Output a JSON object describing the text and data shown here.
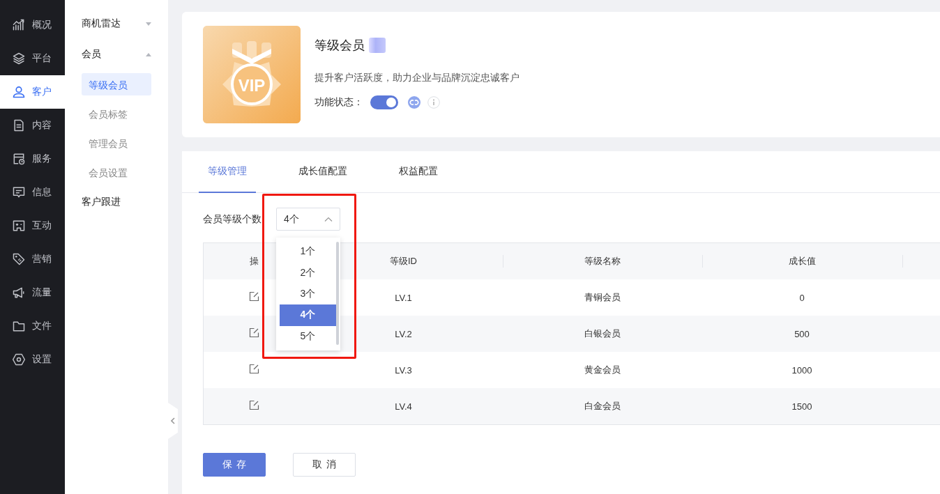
{
  "nav": [
    {
      "label": "概况",
      "selected": false
    },
    {
      "label": "平台",
      "selected": false
    },
    {
      "label": "客户",
      "selected": true
    },
    {
      "label": "内容",
      "selected": false
    },
    {
      "label": "服务",
      "selected": false
    },
    {
      "label": "信息",
      "selected": false
    },
    {
      "label": "互动",
      "selected": false
    },
    {
      "label": "营销",
      "selected": false
    },
    {
      "label": "流量",
      "selected": false
    },
    {
      "label": "文件",
      "selected": false
    },
    {
      "label": "设置",
      "selected": false
    }
  ],
  "subnav": [
    {
      "label": "商机雷达",
      "kind": "group",
      "expanded": false
    },
    {
      "label": "会员",
      "kind": "group",
      "expanded": true,
      "children": [
        {
          "label": "等级会员",
          "selected": true
        },
        {
          "label": "会员标签",
          "selected": false
        },
        {
          "label": "管理会员",
          "selected": false
        },
        {
          "label": "会员设置",
          "selected": false
        }
      ]
    },
    {
      "label": "客户跟进",
      "kind": "link"
    }
  ],
  "feature": {
    "badge_text": "VIP",
    "title": "等级会员",
    "description": "提升客户活跃度，助力企业与品牌沉淀忠诚客户",
    "status_label": "功能状态：",
    "enabled": true
  },
  "tabs": [
    {
      "label": "等级管理",
      "selected": true
    },
    {
      "label": "成长值配置",
      "selected": false
    },
    {
      "label": "权益配置",
      "selected": false
    }
  ],
  "count_field": {
    "label": "会员等级个数",
    "value": "4个",
    "expanded": true,
    "options": [
      {
        "label": "1个",
        "selected": false
      },
      {
        "label": "2个",
        "selected": false
      },
      {
        "label": "3个",
        "selected": false
      },
      {
        "label": "4个",
        "selected": true
      },
      {
        "label": "5个",
        "selected": false
      }
    ]
  },
  "table": {
    "columns": [
      "操",
      "等级ID",
      "等级名称",
      "成长值"
    ],
    "rows": [
      {
        "level_id": "LV.1",
        "name": "青铜会员",
        "growth": "0"
      },
      {
        "level_id": "LV.2",
        "name": "白银会员",
        "growth": "500"
      },
      {
        "level_id": "LV.3",
        "name": "黄金会员",
        "growth": "1000"
      },
      {
        "level_id": "LV.4",
        "name": "白金会员",
        "growth": "1500"
      }
    ]
  },
  "buttons": [
    {
      "label": "保存",
      "kind": "primary"
    },
    {
      "label": "取消",
      "kind": "default"
    }
  ]
}
